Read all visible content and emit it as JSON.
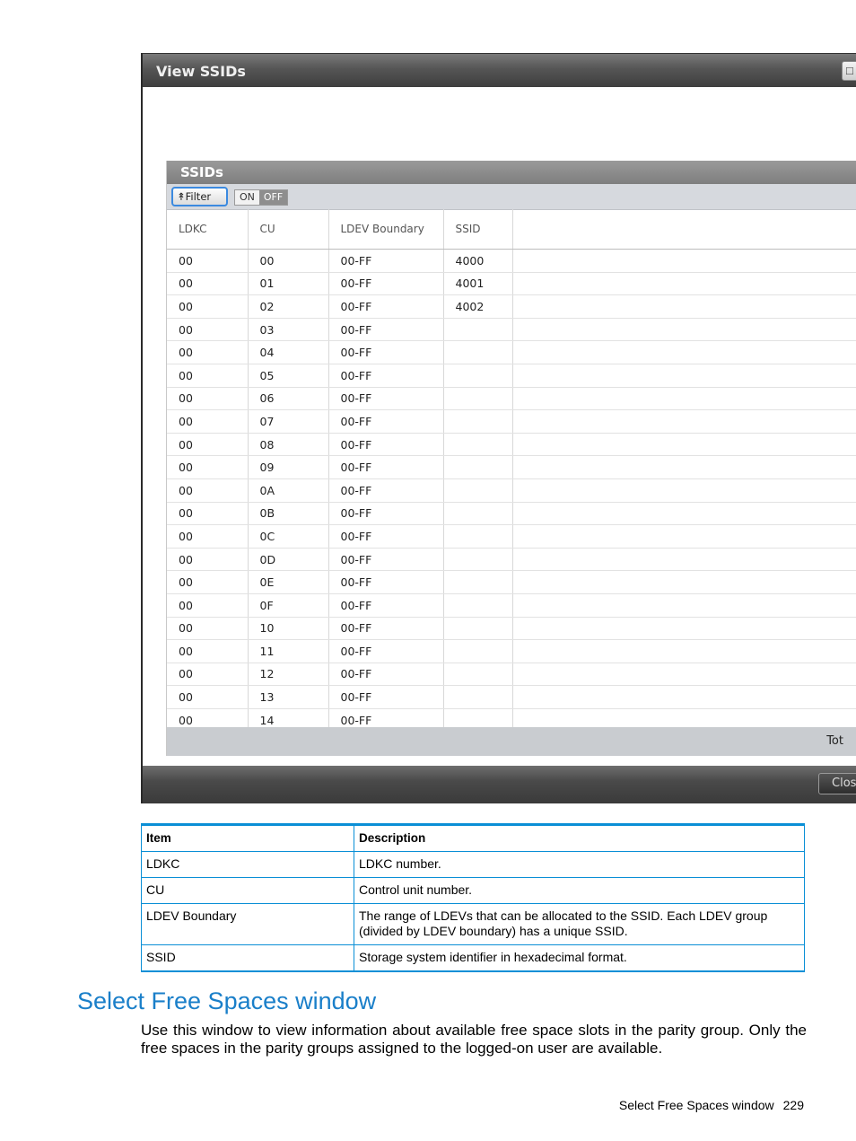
{
  "window": {
    "title": "View SSIDs",
    "max_icon": "maximize-icon",
    "close_label": "Clos"
  },
  "panel": {
    "title": "SSIDs",
    "filter_label": "Filter",
    "filter_icon": "double-chevron-up-icon",
    "toggle_on": "ON",
    "toggle_off": "OFF",
    "total_label": "Tot"
  },
  "grid": {
    "columns": [
      "LDKC",
      "CU",
      "LDEV Boundary",
      "SSID"
    ],
    "rows": [
      [
        "00",
        "00",
        "00-FF",
        "4000"
      ],
      [
        "00",
        "01",
        "00-FF",
        "4001"
      ],
      [
        "00",
        "02",
        "00-FF",
        "4002"
      ],
      [
        "00",
        "03",
        "00-FF",
        ""
      ],
      [
        "00",
        "04",
        "00-FF",
        ""
      ],
      [
        "00",
        "05",
        "00-FF",
        ""
      ],
      [
        "00",
        "06",
        "00-FF",
        ""
      ],
      [
        "00",
        "07",
        "00-FF",
        ""
      ],
      [
        "00",
        "08",
        "00-FF",
        ""
      ],
      [
        "00",
        "09",
        "00-FF",
        ""
      ],
      [
        "00",
        "0A",
        "00-FF",
        ""
      ],
      [
        "00",
        "0B",
        "00-FF",
        ""
      ],
      [
        "00",
        "0C",
        "00-FF",
        ""
      ],
      [
        "00",
        "0D",
        "00-FF",
        ""
      ],
      [
        "00",
        "0E",
        "00-FF",
        ""
      ],
      [
        "00",
        "0F",
        "00-FF",
        ""
      ],
      [
        "00",
        "10",
        "00-FF",
        ""
      ],
      [
        "00",
        "11",
        "00-FF",
        ""
      ],
      [
        "00",
        "12",
        "00-FF",
        ""
      ],
      [
        "00",
        "13",
        "00-FF",
        ""
      ],
      [
        "00",
        "14",
        "00-FF",
        ""
      ]
    ]
  },
  "desc_table": {
    "headers": [
      "Item",
      "Description"
    ],
    "rows": [
      [
        "LDKC",
        "LDKC number."
      ],
      [
        "CU",
        "Control unit number."
      ],
      [
        "LDEV Boundary",
        "The range of LDEVs that can be allocated to the SSID. Each LDEV group (divided by LDEV boundary) has a unique SSID."
      ],
      [
        "SSID",
        "Storage system identifier in hexadecimal format."
      ]
    ]
  },
  "section": {
    "heading": "Select Free Spaces window",
    "body": "Use this window to view information about available free space slots in the parity group. Only the free spaces in the parity groups assigned to the logged-on user are available."
  },
  "footer": {
    "label": "Select Free Spaces window",
    "page": "229"
  },
  "colors": {
    "accent": "#1a7fc9",
    "table_border": "#0a8fd6",
    "filter_focus": "#3b8ae0"
  }
}
